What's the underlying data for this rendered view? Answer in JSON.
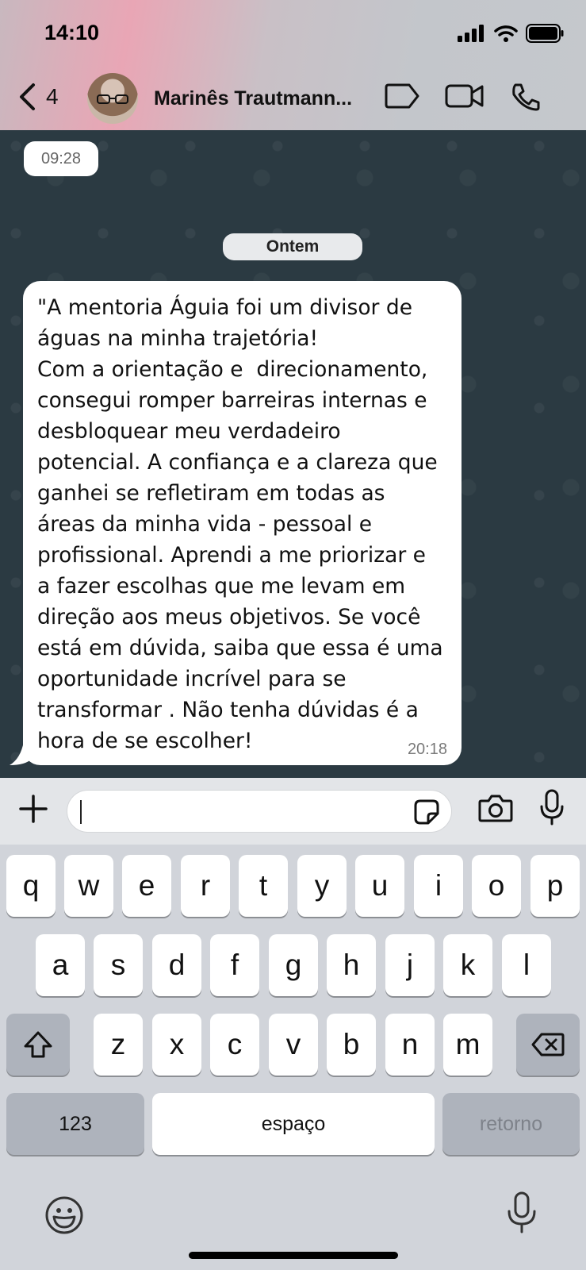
{
  "status_bar": {
    "time": "14:10"
  },
  "header": {
    "back_count": "4",
    "contact_name": "Marinês Trautmann...",
    "icons": [
      "chevron-left-icon",
      "label-tag-icon",
      "video-call-icon",
      "phone-icon"
    ]
  },
  "chat": {
    "top_time_pill": "09:28",
    "date_separator": "Ontem",
    "messages": [
      {
        "text": "\"A mentoria Águia foi um divisor de\náguas na minha trajetória!\nCom a orientação e  direcionamento,\nconsegui romper barreiras internas e\ndesbloquear meu verdadeiro\npotencial. A confiança e a clareza que\nganhei se refletiram em todas as\náreas da minha vida - pessoal e\nprofissional. Aprendi a me priorizar e\na fazer escolhas que me levam em\ndireção aos meus objetivos. Se você\nestá em dúvida, saiba que essa é uma\noportunidade incrível para se\ntransformar . Não tenha dúvidas é a\nhora de se escolher!",
        "time": "20:18"
      }
    ]
  },
  "composer": {
    "input_value": "",
    "icons": [
      "plus-icon",
      "sticker-icon",
      "camera-icon",
      "microphone-icon"
    ]
  },
  "keyboard": {
    "row1": [
      "q",
      "w",
      "e",
      "r",
      "t",
      "y",
      "u",
      "i",
      "o",
      "p"
    ],
    "row2": [
      "a",
      "s",
      "d",
      "f",
      "g",
      "h",
      "j",
      "k",
      "l"
    ],
    "row3": [
      "z",
      "x",
      "c",
      "v",
      "b",
      "n",
      "m"
    ],
    "numbers_label": "123",
    "space_label": "espaço",
    "return_label": "retorno"
  }
}
